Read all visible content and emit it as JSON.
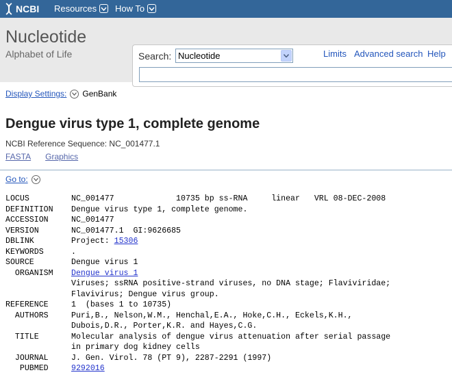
{
  "topbar": {
    "logo_text": "NCBI",
    "menus": [
      "Resources",
      "How To"
    ]
  },
  "header": {
    "title": "Nucleotide",
    "subtitle": "Alphabet of Life",
    "search_label": "Search:",
    "search_db": "Nucleotide",
    "search_value": "",
    "links": [
      "Limits",
      "Advanced search",
      "Help"
    ]
  },
  "display": {
    "label": "Display Settings:",
    "value": "GenBank"
  },
  "record": {
    "title": "Dengue virus type 1, complete genome",
    "refseq": "NCBI Reference Sequence: NC_001477.1",
    "links": [
      "FASTA",
      "Graphics"
    ],
    "goto": "Go to:"
  },
  "genbank": {
    "locus": {
      "key": "LOCUS",
      "value": "NC_001477             10735 bp ss-RNA     linear   VRL 08-DEC-2008"
    },
    "definition": {
      "key": "DEFINITION",
      "value": "Dengue virus type 1, complete genome."
    },
    "accession": {
      "key": "ACCESSION",
      "value": "NC_001477"
    },
    "version": {
      "key": "VERSION",
      "value": "NC_001477.1  GI:9626685"
    },
    "dblink": {
      "key": "DBLINK",
      "prefix": "Project: ",
      "link": "15306"
    },
    "keywords": {
      "key": "KEYWORDS",
      "value": "."
    },
    "source": {
      "key": "SOURCE",
      "value": "Dengue virus 1"
    },
    "organism": {
      "key": "  ORGANISM",
      "link": "Dengue virus 1",
      "lines": [
        "Viruses; ssRNA positive-strand viruses, no DNA stage; Flaviviridae;",
        "Flavivirus; Dengue virus group."
      ]
    },
    "reference": {
      "key": "REFERENCE",
      "value": "1  (bases 1 to 10735)"
    },
    "authors": {
      "key": "  AUTHORS",
      "lines": [
        "Puri,B., Nelson,W.M., Henchal,E.A., Hoke,C.H., Eckels,K.H.,",
        "Dubois,D.R., Porter,K.R. and Hayes,C.G."
      ]
    },
    "title": {
      "key": "  TITLE",
      "lines": [
        "Molecular analysis of dengue virus attenuation after serial passage",
        "in primary dog kidney cells"
      ]
    },
    "journal": {
      "key": "  JOURNAL",
      "value": "J. Gen. Virol. 78 (PT 9), 2287-2291 (1997)"
    },
    "pubmed": {
      "key": "   PUBMED",
      "link": "9292016"
    }
  },
  "colors": {
    "topbar": "#336699",
    "header_bg": "#e9e9e9",
    "link": "#2255bb"
  }
}
